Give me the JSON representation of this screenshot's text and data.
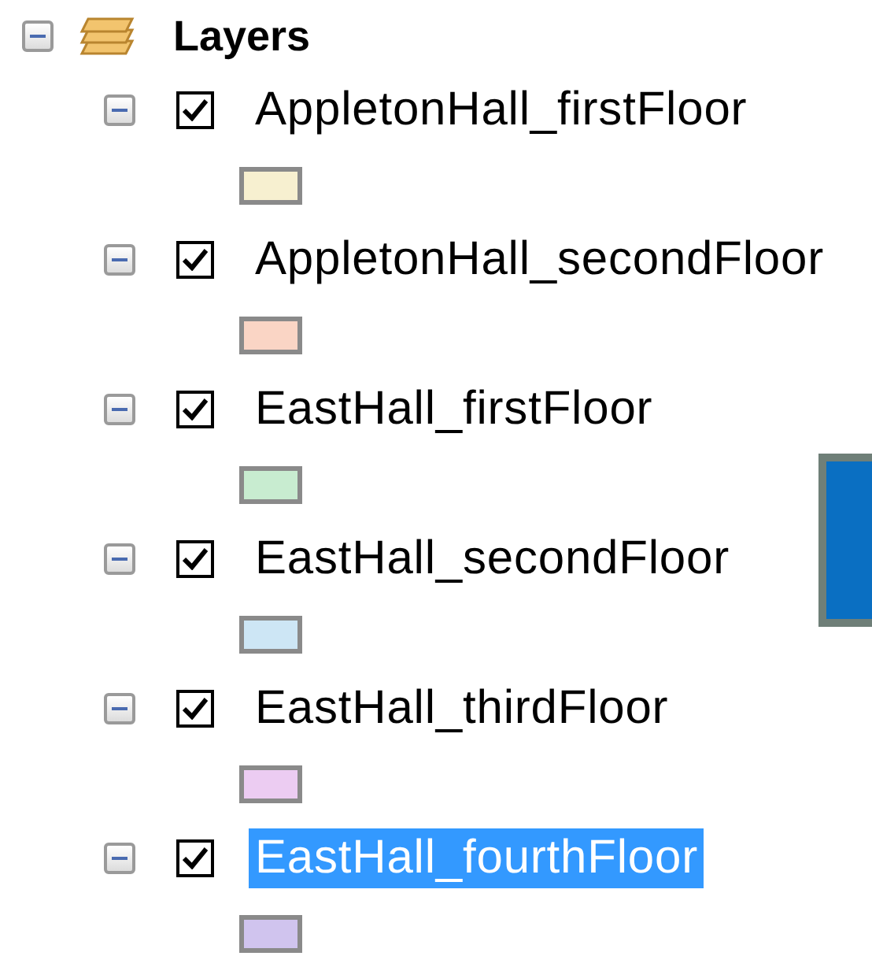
{
  "toc": {
    "label": "Layers",
    "expanded": true,
    "layers": [
      {
        "name": "AppletonHall_firstFloor",
        "expanded": true,
        "checked": true,
        "selected": false,
        "color": "#f7f0d0"
      },
      {
        "name": "AppletonHall_secondFloor",
        "expanded": true,
        "checked": true,
        "selected": false,
        "color": "#fad5c5"
      },
      {
        "name": "EastHall_firstFloor",
        "expanded": true,
        "checked": true,
        "selected": false,
        "color": "#c8ecd0"
      },
      {
        "name": "EastHall_secondFloor",
        "expanded": true,
        "checked": true,
        "selected": false,
        "color": "#cde6f5"
      },
      {
        "name": "EastHall_thirdFloor",
        "expanded": true,
        "checked": true,
        "selected": false,
        "color": "#ecccf2"
      },
      {
        "name": "EastHall_fourthFloor",
        "expanded": true,
        "checked": true,
        "selected": true,
        "color": "#d0c4ee"
      }
    ]
  }
}
